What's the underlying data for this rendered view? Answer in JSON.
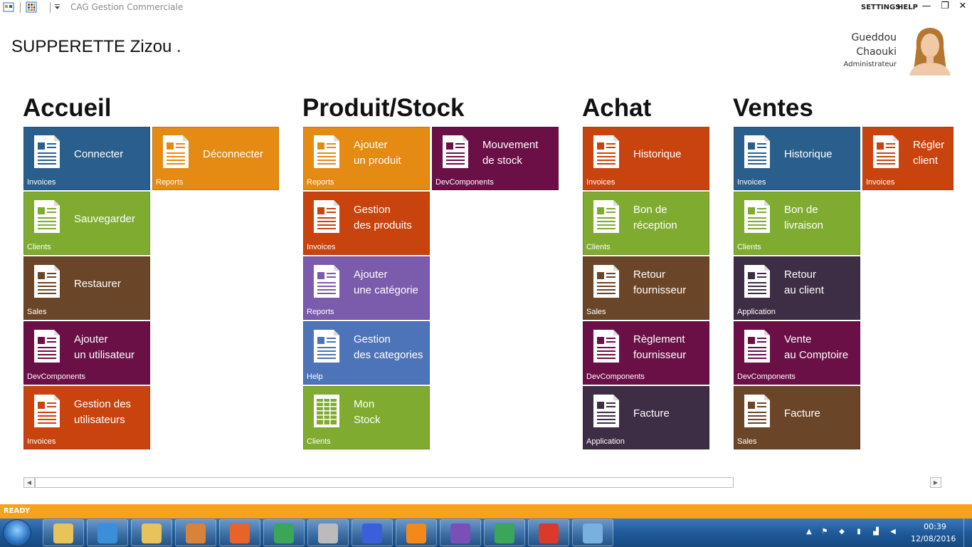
{
  "window": {
    "title": "CAG Gestion Commerciale",
    "settings_label": "SETTINGS",
    "help_label": "HELP",
    "minimize_glyph": "—",
    "restore_glyph": "❐",
    "close_glyph": "✕"
  },
  "header": {
    "store_name": "SUPPERETTE Zizou .",
    "user_first_name": "Gueddou",
    "user_last_name": "Chaouki",
    "user_role": "Administrateur"
  },
  "groups": [
    {
      "title": "Accueil",
      "tiles": [
        {
          "label": "Connecter",
          "category": "Invoices",
          "color": "#2a5e8c",
          "icon": "document-icon"
        },
        {
          "label": "Déconnecter",
          "category": "Reports",
          "color": "#e58a12",
          "icon": "document-icon"
        },
        {
          "label": "Sauvegarder",
          "category": "Clients",
          "color": "#7fab31",
          "icon": "document-icon"
        },
        {
          "label": "Restaurer",
          "category": "Sales",
          "color": "#6b4528",
          "icon": "document-icon"
        },
        {
          "label": "Ajouter\nun utilisateur",
          "category": "DevComponents",
          "color": "#6b0f47",
          "icon": "document-icon"
        },
        {
          "label": "Gestion des\nutilisateurs",
          "category": "Invoices",
          "color": "#c9430f",
          "icon": "document-icon"
        }
      ]
    },
    {
      "title": "Produit/Stock",
      "tiles": [
        {
          "label": "Ajouter\nun produit",
          "category": "Reports",
          "color": "#e58a12",
          "icon": "document-icon"
        },
        {
          "label": "Mouvement\nde stock",
          "category": "DevComponents",
          "color": "#6b0f47",
          "icon": "document-icon"
        },
        {
          "label": "Gestion\ndes produits",
          "category": "Invoices",
          "color": "#c9430f",
          "icon": "document-icon"
        },
        {
          "label": "Ajouter\nune catégorie",
          "category": "Reports",
          "color": "#7b5bab",
          "icon": "document-icon"
        },
        {
          "label": "Gestion\ndes categories",
          "category": "Help",
          "color": "#4d74b8",
          "icon": "document-icon"
        },
        {
          "label": "Mon\nStock",
          "category": "Clients",
          "color": "#7fab31",
          "icon": "spreadsheet-icon"
        }
      ]
    },
    {
      "title": "Achat",
      "tiles": [
        {
          "label": "Historique",
          "category": "Invoices",
          "color": "#c9430f",
          "icon": "document-icon"
        },
        {
          "label": "Bon de\nréception",
          "category": "Clients",
          "color": "#7fab31",
          "icon": "document-icon"
        },
        {
          "label": "Retour\nfournisseur",
          "category": "Sales",
          "color": "#6b4528",
          "icon": "document-icon"
        },
        {
          "label": "Règlement\nfournisseur",
          "category": "DevComponents",
          "color": "#6b0f47",
          "icon": "document-icon"
        },
        {
          "label": "Facture",
          "category": "Application",
          "color": "#3d2d45",
          "icon": "document-icon"
        }
      ]
    },
    {
      "title": "Ventes",
      "tiles": [
        {
          "label": "Historique",
          "category": "Invoices",
          "color": "#2a5e8c",
          "icon": "document-icon"
        },
        {
          "label": "Régler\nclient",
          "category": "Invoices",
          "color": "#c9430f",
          "icon": "document-icon"
        },
        {
          "label": "Bon de\nlivraison",
          "category": "Clients",
          "color": "#7fab31",
          "icon": "document-icon"
        },
        {
          "label": "Retour\nau client",
          "category": "Application",
          "color": "#3d2d45",
          "icon": "document-icon"
        },
        {
          "label": "Vente\nau Comptoire",
          "category": "DevComponents",
          "color": "#6b0f47",
          "icon": "document-icon"
        },
        {
          "label": "Facture",
          "category": "Sales",
          "color": "#6b4528",
          "icon": "document-icon"
        }
      ]
    }
  ],
  "scrollbar": {
    "left_glyph": "◀",
    "right_glyph": "▶"
  },
  "status": {
    "text": "READY"
  },
  "taskbar": {
    "apps": [
      "explorer-icon",
      "ie-icon",
      "file-manager-icon",
      "media-player-icon",
      "firefox-icon",
      "chrome-icon",
      "printer-icon",
      "star-app-icon",
      "vlc-icon",
      "visual-studio-icon",
      "google-drive-icon",
      "app-window-icon",
      "paint-icon"
    ],
    "clock_time": "00:39",
    "clock_date": "12/08/2016"
  }
}
